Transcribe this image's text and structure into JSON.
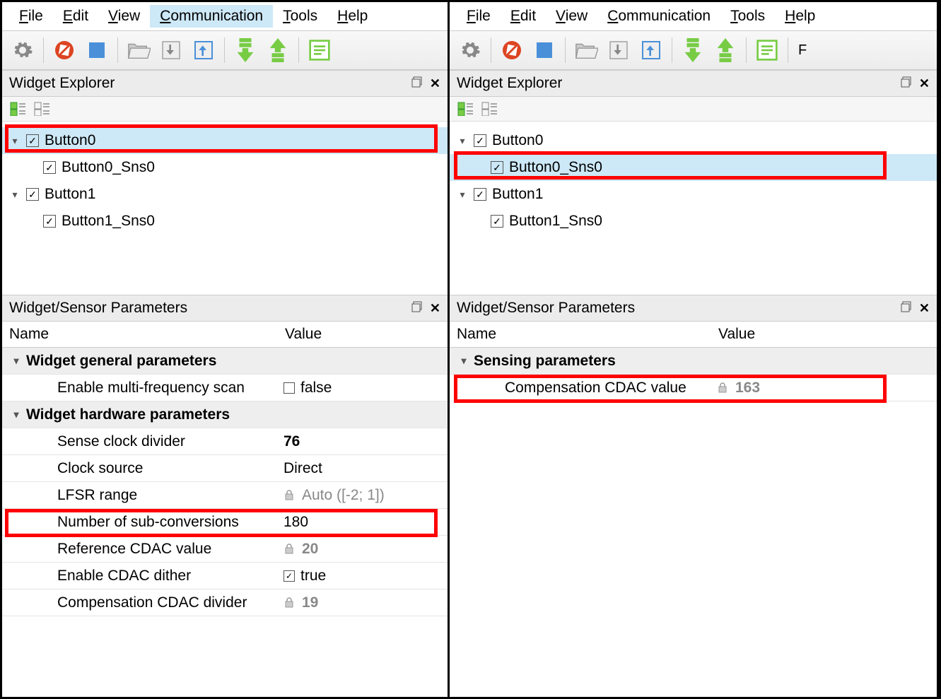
{
  "menus": {
    "file": "File",
    "edit": "Edit",
    "view": "View",
    "comm": "Communication",
    "tools": "Tools",
    "help": "Help"
  },
  "panels": {
    "explorer": "Widget Explorer",
    "params": "Widget/Sensor Parameters"
  },
  "cols": {
    "name": "Name",
    "value": "Value"
  },
  "tree": {
    "b0": "Button0",
    "b0s": "Button0_Sns0",
    "b1": "Button1",
    "b1s": "Button1_Sns0"
  },
  "left": {
    "grp1": "Widget general parameters",
    "grp2": "Widget hardware parameters",
    "p1": {
      "name": "Enable multi-frequency scan",
      "value": "false"
    },
    "p2": {
      "name": "Sense clock divider",
      "value": "76"
    },
    "p3": {
      "name": "Clock source",
      "value": "Direct"
    },
    "p4": {
      "name": "LFSR range",
      "value": "Auto ([-2; 1])"
    },
    "p5": {
      "name": "Number of sub-conversions",
      "value": "180"
    },
    "p6": {
      "name": "Reference CDAC value",
      "value": "20"
    },
    "p7": {
      "name": "Enable CDAC dither",
      "value": "true"
    },
    "p8": {
      "name": "Compensation CDAC divider",
      "value": "19"
    }
  },
  "right": {
    "grp1": "Sensing parameters",
    "p1": {
      "name": "Compensation CDAC value",
      "value": "163"
    }
  }
}
